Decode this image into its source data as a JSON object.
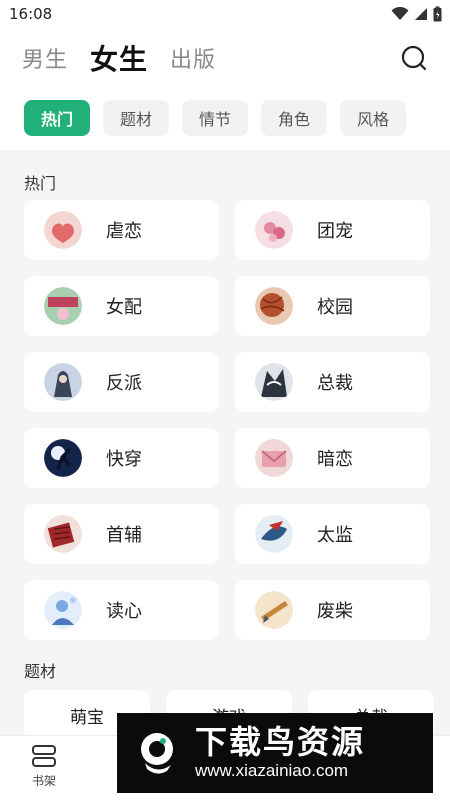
{
  "status_bar": {
    "time": "16:08"
  },
  "top_nav": {
    "tabs": [
      {
        "label": "男生"
      },
      {
        "label": "女生"
      },
      {
        "label": "出版"
      }
    ],
    "active": "女生"
  },
  "chips": [
    {
      "label": "热门"
    },
    {
      "label": "题材"
    },
    {
      "label": "情节"
    },
    {
      "label": "角色"
    },
    {
      "label": "风格"
    }
  ],
  "sections": {
    "hot": {
      "title": "热门",
      "items": [
        {
          "label": "虐恋",
          "color": "#e8a0a0"
        },
        {
          "label": "团宠",
          "color": "#f0c0cc"
        },
        {
          "label": "女配",
          "color": "#d86a8a"
        },
        {
          "label": "校园",
          "color": "#b85a3a"
        },
        {
          "label": "反派",
          "color": "#4a5a7a"
        },
        {
          "label": "总裁",
          "color": "#6a7a8a"
        },
        {
          "label": "快穿",
          "color": "#1f3f7f"
        },
        {
          "label": "暗恋",
          "color": "#e0a8b0"
        },
        {
          "label": "首辅",
          "color": "#a03030"
        },
        {
          "label": "太监",
          "color": "#3a6a9a"
        },
        {
          "label": "读心",
          "color": "#7aa8e0"
        },
        {
          "label": "废柴",
          "color": "#c89050"
        }
      ]
    },
    "theme": {
      "title": "题材",
      "items": [
        {
          "label": "萌宝"
        },
        {
          "label": "游戏"
        },
        {
          "label": "总裁"
        }
      ]
    }
  },
  "bottom_nav": {
    "items": [
      {
        "label": "书架"
      }
    ]
  },
  "watermark": {
    "title": "下载鸟资源",
    "url": "www.xiazainiao.com"
  },
  "colors": {
    "accent": "#21b07a",
    "background": "#f5f5f5"
  }
}
